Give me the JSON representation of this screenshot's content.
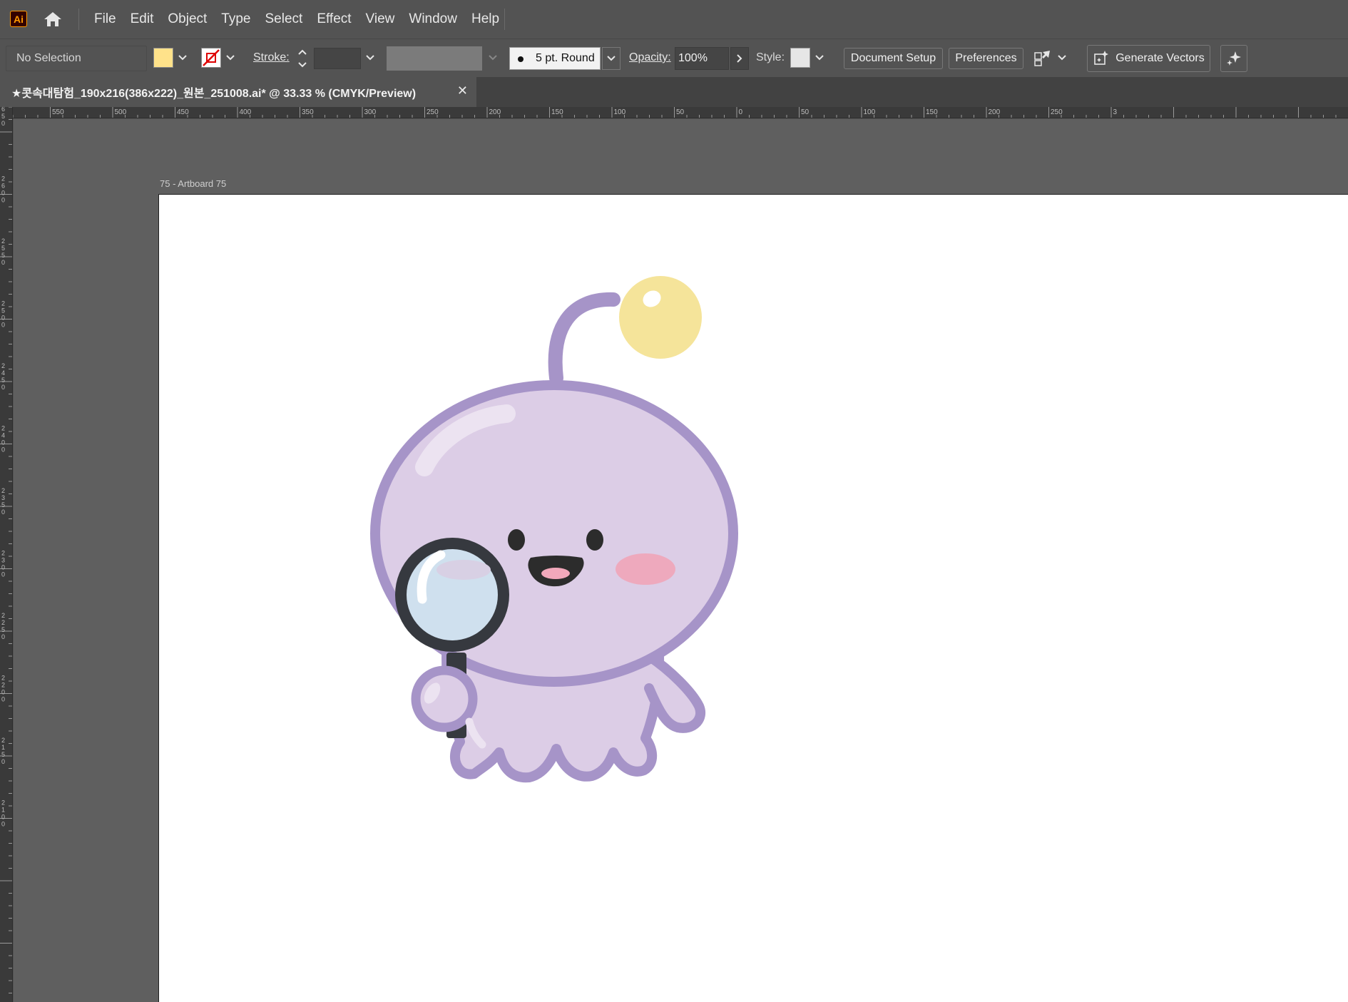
{
  "app": {
    "logo": "Ai",
    "home_icon": "home-icon"
  },
  "menu": [
    "File",
    "Edit",
    "Object",
    "Type",
    "Select",
    "Effect",
    "View",
    "Window",
    "Help"
  ],
  "control_bar": {
    "selection_label": "No Selection",
    "fill_color": "#ffe28a",
    "stroke_label": "Stroke:",
    "brush_value": "5 pt. Round",
    "opacity_label": "Opacity:",
    "opacity_value": "100%",
    "style_label": "Style:",
    "document_setup_label": "Document Setup",
    "preferences_label": "Preferences",
    "generate_vectors_label": "Generate Vectors"
  },
  "document_tab": {
    "title": "★콧속대탐험_190x216(386x222)_원본_251008.ai* @ 33.33 % (CMYK/Preview)",
    "close_icon": "✕"
  },
  "rulers": {
    "top_labels": [
      "550",
      "500",
      "450",
      "400",
      "350",
      "300",
      "250",
      "200",
      "150",
      "100",
      "50",
      "0",
      "50",
      "100",
      "150",
      "200",
      "250",
      "3"
    ],
    "left_labels": [
      "650",
      "2600",
      "2550",
      "2500",
      "2450",
      "2400",
      "2350",
      "2300",
      "2250",
      "2200",
      "2150",
      "2100"
    ]
  },
  "artboard": {
    "label": "75 - Artboard 75"
  },
  "colors": {
    "body_fill": "#dccde6",
    "body_outline": "#a694c8",
    "bulb": "#f5e49a",
    "cheek": "#eea9bd",
    "lens": "#cfe0ee",
    "magnifier": "#36393f"
  }
}
